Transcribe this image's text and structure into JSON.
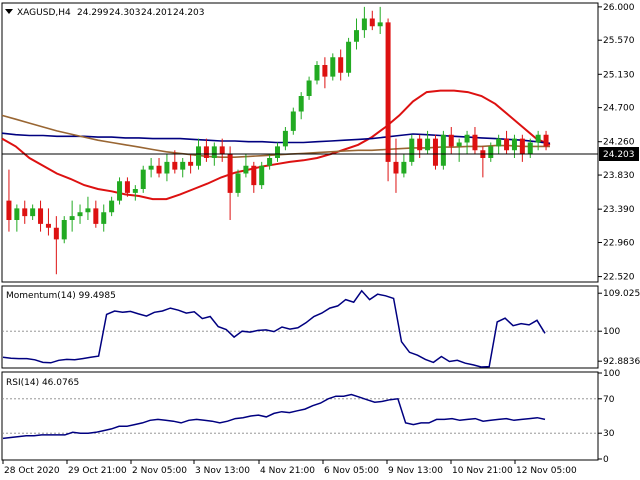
{
  "chart_data": [
    {
      "type": "candlestick",
      "symbol": "XAGUSD,H4",
      "ohlc_header": [
        "24.299",
        "24.303",
        "24.201",
        "24.203"
      ],
      "current_price": "24.203",
      "y_ticks": [
        "26.000",
        "25.570",
        "25.130",
        "24.700",
        "24.260",
        "23.830",
        "23.390",
        "22.960",
        "22.520"
      ],
      "ylim": [
        22.45,
        26.05
      ],
      "bull_color": "#22aa22",
      "bear_color": "#dd1111",
      "candles": [
        [
          23.5,
          23.9,
          23.1,
          23.25
        ],
        [
          23.25,
          23.45,
          23.1,
          23.4
        ],
        [
          23.4,
          23.5,
          23.2,
          23.3
        ],
        [
          23.3,
          23.45,
          23.25,
          23.4
        ],
        [
          23.4,
          23.5,
          23.1,
          23.2
        ],
        [
          23.2,
          23.4,
          23.05,
          23.15
        ],
        [
          23.15,
          23.3,
          22.55,
          23.0
        ],
        [
          23.0,
          23.3,
          22.95,
          23.25
        ],
        [
          23.25,
          23.5,
          23.1,
          23.3
        ],
        [
          23.3,
          23.45,
          23.2,
          23.35
        ],
        [
          23.35,
          23.55,
          23.25,
          23.4
        ],
        [
          23.4,
          23.5,
          23.15,
          23.2
        ],
        [
          23.2,
          23.45,
          23.1,
          23.35
        ],
        [
          23.35,
          23.55,
          23.3,
          23.5
        ],
        [
          23.5,
          23.8,
          23.45,
          23.75
        ],
        [
          23.75,
          23.8,
          23.55,
          23.6
        ],
        [
          23.6,
          23.7,
          23.5,
          23.65
        ],
        [
          23.65,
          23.95,
          23.6,
          23.9
        ],
        [
          23.9,
          24.05,
          23.8,
          23.95
        ],
        [
          23.95,
          24.05,
          23.8,
          23.85
        ],
        [
          23.85,
          24.1,
          23.75,
          24.0
        ],
        [
          24.0,
          24.15,
          23.85,
          23.9
        ],
        [
          23.9,
          24.05,
          23.8,
          24.0
        ],
        [
          24.0,
          24.1,
          23.85,
          23.95
        ],
        [
          23.95,
          24.3,
          23.9,
          24.2
        ],
        [
          24.2,
          24.3,
          24.0,
          24.05
        ],
        [
          24.05,
          24.25,
          23.95,
          24.2
        ],
        [
          24.2,
          24.3,
          24.0,
          24.1
        ],
        [
          24.1,
          24.2,
          23.25,
          23.6
        ],
        [
          23.6,
          23.9,
          23.55,
          23.85
        ],
        [
          23.85,
          24.1,
          23.8,
          23.95
        ],
        [
          23.95,
          24.0,
          23.6,
          23.7
        ],
        [
          23.7,
          24.0,
          23.65,
          23.95
        ],
        [
          23.95,
          24.1,
          23.9,
          24.05
        ],
        [
          24.05,
          24.25,
          24.0,
          24.2
        ],
        [
          24.2,
          24.45,
          24.15,
          24.4
        ],
        [
          24.4,
          24.7,
          24.35,
          24.65
        ],
        [
          24.65,
          24.9,
          24.55,
          24.85
        ],
        [
          24.85,
          25.1,
          24.8,
          25.05
        ],
        [
          25.05,
          25.3,
          25.0,
          25.25
        ],
        [
          25.25,
          25.35,
          24.95,
          25.1
        ],
        [
          25.1,
          25.4,
          25.05,
          25.35
        ],
        [
          25.35,
          25.45,
          25.05,
          25.15
        ],
        [
          25.15,
          25.6,
          25.1,
          25.55
        ],
        [
          25.55,
          25.85,
          25.45,
          25.7
        ],
        [
          25.7,
          26.0,
          25.6,
          25.85
        ],
        [
          25.85,
          25.95,
          25.7,
          25.75
        ],
        [
          25.75,
          26.0,
          25.65,
          25.8
        ],
        [
          25.8,
          25.85,
          23.75,
          24.0
        ],
        [
          24.0,
          24.3,
          23.6,
          23.85
        ],
        [
          23.85,
          24.1,
          23.8,
          24.0
        ],
        [
          24.0,
          24.35,
          23.95,
          24.3
        ],
        [
          24.3,
          24.35,
          24.05,
          24.15
        ],
        [
          24.15,
          24.4,
          24.1,
          24.3
        ],
        [
          24.3,
          24.35,
          23.9,
          23.95
        ],
        [
          23.95,
          24.4,
          23.9,
          24.35
        ],
        [
          24.35,
          24.45,
          24.1,
          24.2
        ],
        [
          24.2,
          24.3,
          24.0,
          24.25
        ],
        [
          24.25,
          24.4,
          24.1,
          24.35
        ],
        [
          24.35,
          24.45,
          24.1,
          24.15
        ],
        [
          24.15,
          24.2,
          23.8,
          24.05
        ],
        [
          24.05,
          24.25,
          24.0,
          24.2
        ],
        [
          24.2,
          24.35,
          24.1,
          24.3
        ],
        [
          24.3,
          24.4,
          24.1,
          24.15
        ],
        [
          24.15,
          24.35,
          24.05,
          24.3
        ],
        [
          24.3,
          24.35,
          24.0,
          24.1
        ],
        [
          24.1,
          24.3,
          24.05,
          24.25
        ],
        [
          24.25,
          24.4,
          24.15,
          24.35
        ],
        [
          24.35,
          24.4,
          24.15,
          24.2
        ]
      ],
      "ma_series": [
        {
          "color": "#dd1111",
          "values": [
            24.3,
            24.2,
            24.05,
            23.95,
            23.85,
            23.78,
            23.7,
            23.65,
            23.62,
            23.58,
            23.56,
            23.52,
            23.52,
            23.58,
            23.65,
            23.72,
            23.8,
            23.86,
            23.9,
            23.94,
            23.97,
            24.0,
            24.02,
            24.05,
            24.1,
            24.16,
            24.22,
            24.32,
            24.45,
            24.6,
            24.78,
            24.9,
            24.92,
            24.92,
            24.9,
            24.85,
            24.75,
            24.6,
            24.45,
            24.3,
            24.22
          ]
        },
        {
          "color": "#000080",
          "values": [
            24.37,
            24.35,
            24.34,
            24.34,
            24.33,
            24.33,
            24.33,
            24.32,
            24.32,
            24.31,
            24.31,
            24.3,
            24.3,
            24.3,
            24.29,
            24.28,
            24.27,
            24.27,
            24.26,
            24.26,
            24.25,
            24.25,
            24.25,
            24.26,
            24.27,
            24.28,
            24.29,
            24.3,
            24.32,
            24.34,
            24.36,
            24.35,
            24.34,
            24.33,
            24.32,
            24.31,
            24.3,
            24.29,
            24.28,
            24.26,
            24.24
          ]
        },
        {
          "color": "#996633",
          "values": [
            24.6,
            24.55,
            24.5,
            24.45,
            24.4,
            24.36,
            24.32,
            24.28,
            24.25,
            24.22,
            24.19,
            24.16,
            24.13,
            24.11,
            24.09,
            24.07,
            24.06,
            24.06,
            24.07,
            24.08,
            24.09,
            24.1,
            24.11,
            24.12,
            24.13,
            24.14,
            24.15,
            24.15,
            24.16,
            24.17,
            24.18,
            24.18,
            24.19,
            24.19,
            24.2,
            24.2,
            24.21,
            24.21,
            24.2,
            24.2,
            24.2
          ]
        }
      ],
      "x_labels": [
        "28 Oct 2020",
        "29 Oct 21:00",
        "2 Nov 05:00",
        "3 Nov 13:00",
        "4 Nov 21:00",
        "6 Nov 05:00",
        "9 Nov 13:00",
        "10 Nov 21:00",
        "12 Nov 05:00"
      ]
    },
    {
      "type": "line",
      "title": "Momentum(14) 99.4985",
      "y_ticks": [
        "109.0251",
        "100",
        "92.8836"
      ],
      "ylim": [
        91.5,
        110.5
      ],
      "reference_level": 100,
      "color": "#000080",
      "values": [
        93.8,
        93.6,
        93.5,
        93.5,
        93.2,
        92.6,
        92.5,
        93.1,
        93.3,
        93.2,
        93.5,
        93.8,
        94.1,
        104.0,
        104.8,
        104.5,
        104.7,
        104.1,
        103.6,
        104.5,
        104.8,
        105.5,
        105.0,
        104.3,
        104.6,
        103.0,
        103.5,
        101.1,
        100.4,
        98.6,
        100.0,
        99.8,
        100.2,
        100.3,
        99.9,
        101.0,
        100.5,
        100.8,
        102.0,
        103.5,
        104.3,
        105.5,
        106.0,
        107.5,
        106.9,
        109.6,
        107.5,
        108.8,
        108.4,
        107.8,
        97.5,
        95.0,
        94.3,
        93.3,
        92.6,
        94.0,
        92.8,
        93.1,
        92.4,
        92.0,
        91.5,
        91.6,
        102.2,
        103.1,
        101.3,
        101.8,
        101.5,
        102.6,
        99.5
      ]
    },
    {
      "type": "line",
      "title": "RSI(14) 46.0765",
      "y_ticks": [
        "100",
        "70",
        "30",
        "0"
      ],
      "ylim": [
        0,
        100
      ],
      "reference_levels": [
        70,
        30
      ],
      "color": "#000080",
      "values": [
        24,
        25,
        26,
        27,
        27,
        28,
        28,
        28,
        28,
        31,
        30,
        30,
        31,
        33,
        35,
        38,
        38,
        40,
        42,
        45,
        46,
        45,
        44,
        42,
        45,
        46,
        45,
        44,
        42,
        44,
        47,
        48,
        50,
        51,
        49,
        53,
        55,
        54,
        56,
        58,
        62,
        65,
        70,
        73,
        73,
        75,
        72,
        69,
        66,
        67,
        69,
        70,
        42,
        40,
        42,
        42,
        46,
        46,
        47,
        45,
        46,
        47,
        44,
        45,
        46,
        47,
        45,
        46,
        47,
        48,
        46
      ]
    }
  ]
}
